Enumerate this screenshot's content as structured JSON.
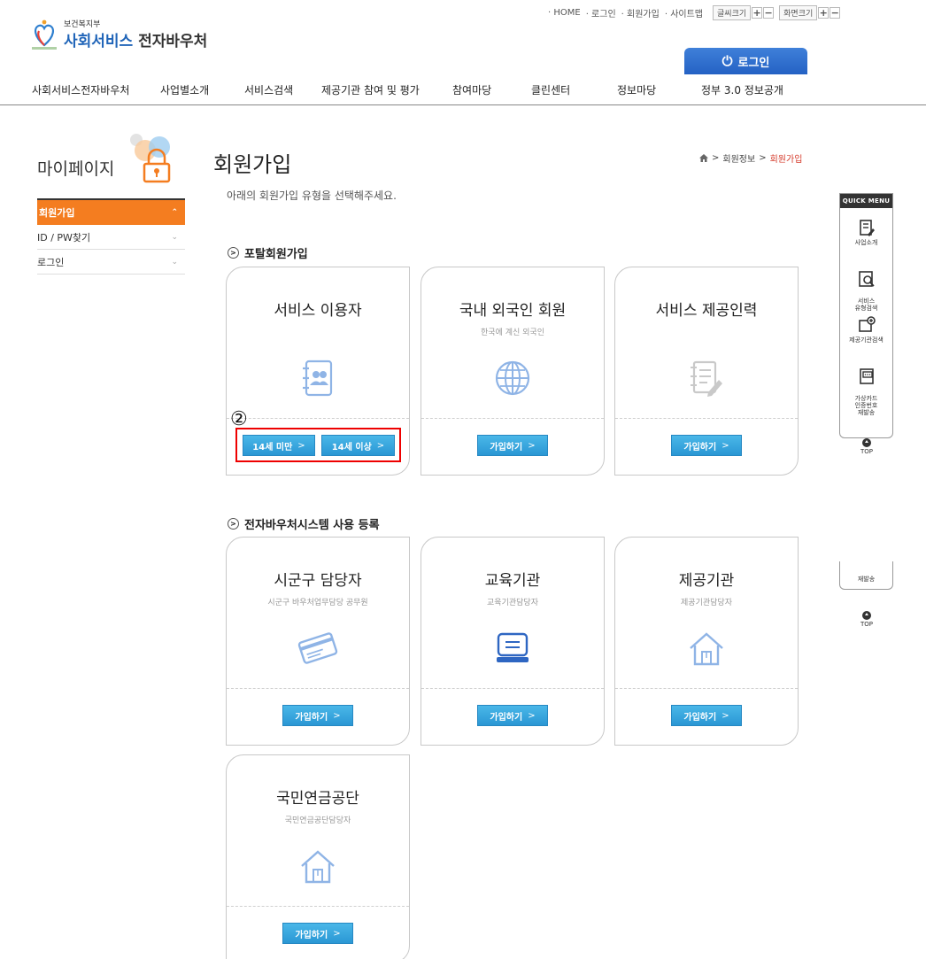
{
  "util": {
    "links": [
      "· HOME",
      "· 로그인",
      "· 회원가입",
      "· 사이트맵"
    ],
    "font_size_label": "글씨크기",
    "screen_size_label": "화면크기",
    "plus": "+",
    "minus": "−"
  },
  "logo": {
    "ministry": "보건복지부",
    "brand_blue": "사회서비스",
    "brand_rest": " 전자바우처"
  },
  "login": {
    "label": "로그인"
  },
  "gnb": [
    "사회서비스전자바우처",
    "사업별소개",
    "서비스검색",
    "제공기관 참여 및 평가",
    "참여마당",
    "클린센터",
    "정보마당",
    "정부 3.0 정보공개"
  ],
  "sidebar": {
    "title": "마이페이지",
    "items": [
      {
        "label": "회원가입",
        "chev": "⌃"
      },
      {
        "label": "ID / PW찾기",
        "chev": "⌄"
      },
      {
        "label": "로그인",
        "chev": "⌄"
      }
    ]
  },
  "main": {
    "title": "회원가입",
    "desc": "아래의 회원가입 유형을 선택해주세요.",
    "breadcrumb": {
      "sep": ">",
      "parent": "회원정보",
      "current": "회원가입"
    },
    "section1": {
      "icon": ">",
      "title": "포탈회원가입"
    },
    "section2": {
      "icon": ">",
      "title": "전자바우처시스템 사용 등록"
    },
    "cards": [
      {
        "title": "서비스 이용자",
        "sub": "",
        "icon": "address-book-icon"
      },
      {
        "title": "국내 외국인 회원",
        "sub": "한국에 계신 외국인",
        "icon": "globe-icon"
      },
      {
        "title": "서비스 제공인력",
        "sub": "",
        "icon": "document-edit-icon"
      },
      {
        "title": "시군구 담당자",
        "sub": "시군구 바우처업무담당 공무원",
        "icon": "card-icon"
      },
      {
        "title": "교육기관",
        "sub": "교육기관담당자",
        "icon": "monitor-icon"
      },
      {
        "title": "제공기관",
        "sub": "제공기관담당자",
        "icon": "house-icon"
      },
      {
        "title": "국민연금공단",
        "sub": "국민연금공단담당자",
        "icon": "house-icon"
      }
    ],
    "buttons": {
      "under14": "14세 미만",
      "over14": "14세 이상",
      "join": "가입하기",
      "arrow": ">"
    },
    "annotation_marker": "②"
  },
  "quick": {
    "header": "QUICK MENU",
    "items": [
      "사업소개",
      "서비스\n유형검색",
      "제공기관검색",
      "가상카드\n인증번호\n재발송"
    ],
    "top": "TOP",
    "ghost_label": "재발송"
  },
  "colors": {
    "accent_orange": "#f47d20",
    "blue_button": "#2a97d4",
    "login_tab": "#2462c4",
    "highlight_red": "#e00000"
  }
}
